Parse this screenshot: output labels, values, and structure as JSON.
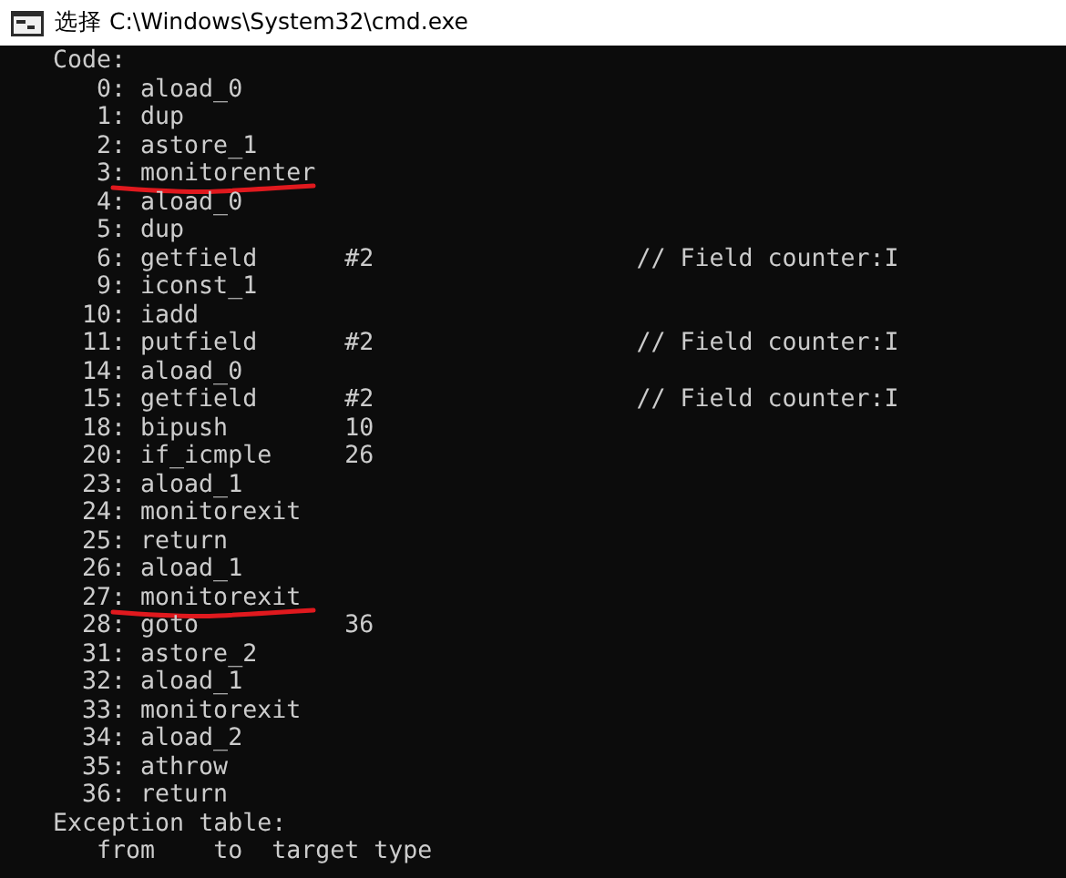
{
  "window": {
    "title": "选择 C:\\Windows\\System32\\cmd.exe"
  },
  "console": {
    "heading": "Code:",
    "rows": [
      {
        "index": "0:",
        "op": "aload_0",
        "underlined": false
      },
      {
        "index": "1:",
        "op": "dup",
        "underlined": false
      },
      {
        "index": "2:",
        "op": "astore_1",
        "underlined": false
      },
      {
        "index": "3:",
        "op": "monitorenter",
        "underlined": true
      },
      {
        "index": "4:",
        "op": "aload_0",
        "underlined": false
      },
      {
        "index": "5:",
        "op": "dup",
        "underlined": false
      },
      {
        "index": "6:",
        "op": "getfield",
        "arg": "#2",
        "comment": "// Field counter:I",
        "underlined": false
      },
      {
        "index": "9:",
        "op": "iconst_1",
        "underlined": false
      },
      {
        "index": "10:",
        "op": "iadd",
        "underlined": false
      },
      {
        "index": "11:",
        "op": "putfield",
        "arg": "#2",
        "comment": "// Field counter:I",
        "underlined": false
      },
      {
        "index": "14:",
        "op": "aload_0",
        "underlined": false
      },
      {
        "index": "15:",
        "op": "getfield",
        "arg": "#2",
        "comment": "// Field counter:I",
        "underlined": false
      },
      {
        "index": "18:",
        "op": "bipush",
        "arg": "10",
        "underlined": false
      },
      {
        "index": "20:",
        "op": "if_icmple",
        "arg": "26",
        "underlined": false
      },
      {
        "index": "23:",
        "op": "aload_1",
        "underlined": false
      },
      {
        "index": "24:",
        "op": "monitorexit",
        "underlined": false
      },
      {
        "index": "25:",
        "op": "return",
        "underlined": false
      },
      {
        "index": "26:",
        "op": "aload_1",
        "underlined": false
      },
      {
        "index": "27:",
        "op": "monitorexit",
        "underlined": true
      },
      {
        "index": "28:",
        "op": "goto",
        "arg": "36",
        "underlined": false
      },
      {
        "index": "31:",
        "op": "astore_2",
        "underlined": false
      },
      {
        "index": "32:",
        "op": "aload_1",
        "underlined": false
      },
      {
        "index": "33:",
        "op": "monitorexit",
        "underlined": false
      },
      {
        "index": "34:",
        "op": "aload_2",
        "underlined": false
      },
      {
        "index": "35:",
        "op": "athrow",
        "underlined": false
      },
      {
        "index": "36:",
        "op": "return",
        "underlined": false
      }
    ],
    "footer": "Exception table:",
    "table_header": "from    to  target type"
  }
}
